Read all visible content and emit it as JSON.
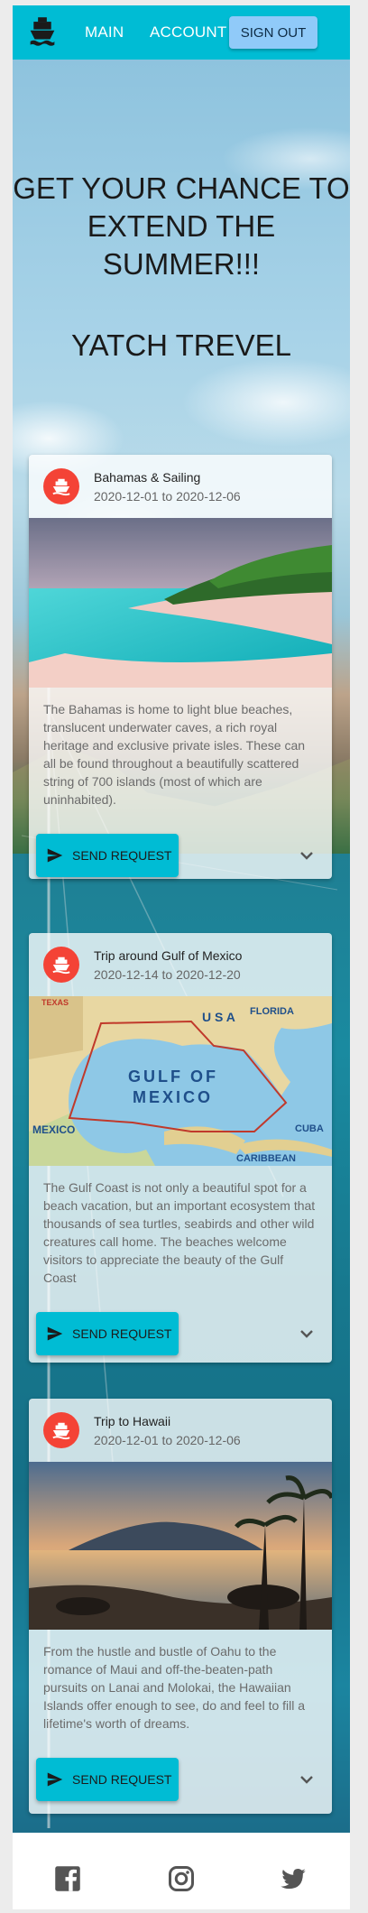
{
  "header": {
    "logo_icon": "ship-icon",
    "nav": [
      {
        "label": "Main"
      },
      {
        "label": "Account"
      }
    ],
    "signout_label": "Sign Out",
    "colors": {
      "bar": "#00bcd4",
      "signout": "#90caf9"
    }
  },
  "hero": {
    "title": "GET YOUR CHANCE TO EXTEND THE SUMMER!!!",
    "subtitle": "YATCH TREVEL"
  },
  "cards": [
    {
      "avatar_icon": "ship-icon",
      "title": "Bahamas & Sailing",
      "dates": "2020-12-01 to 2020-12-06",
      "image": "beach-island-image",
      "description": "The Bahamas is home to light blue beaches, translucent underwater caves, a rich royal heritage and exclusive private isles. These can all be found throughout a beautifully scattered string of 700 islands (most of which are uninhabited).",
      "button_label": "Send Request",
      "expand_icon": "chevron-down-icon"
    },
    {
      "avatar_icon": "ship-icon",
      "title": "Trip around Gulf of Mexico",
      "dates": "2020-12-14 to 2020-12-20",
      "image": "gulf-of-mexico-map",
      "map_labels": {
        "main1": "GULF OF",
        "main2": "MEXICO",
        "usa": "U S A",
        "florida": "FLORIDA",
        "cuba": "CUBA",
        "mexico": "MEXICO",
        "caribbean": "CARIBBEAN",
        "texas": "TEXAS"
      },
      "description": "The Gulf Coast is not only a beautiful spot for a beach vacation, but an important ecosystem that thousands of sea turtles, seabirds and other wild creatures call home. The beaches welcome visitors to appreciate the beauty of the Gulf Coast",
      "button_label": "Send Request",
      "expand_icon": "chevron-down-icon"
    },
    {
      "avatar_icon": "ship-icon",
      "title": "Trip to Hawaii",
      "dates": "2020-12-01 to 2020-12-06",
      "image": "hawaii-sunset-image",
      "description": "From the hustle and bustle of Oahu to the romance of Maui and off-the-beaten-path pursuits on Lanai and Molokai, the Hawaiian Islands offer enough to see, do and feel to fill a lifetime's worth of dreams.",
      "button_label": "Send Request",
      "expand_icon": "chevron-down-icon"
    }
  ],
  "footer": {
    "icons": [
      "facebook-icon",
      "instagram-icon",
      "twitter-icon"
    ]
  }
}
